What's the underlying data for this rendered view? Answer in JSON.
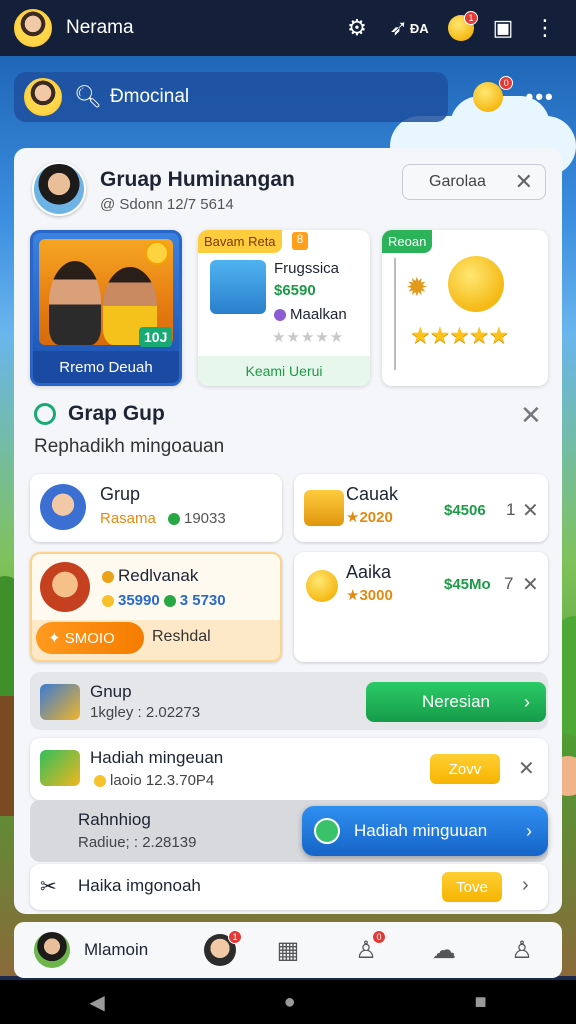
{
  "topbar": {
    "title": "Nerama",
    "label_small": "ĐA",
    "badge": "1"
  },
  "search": {
    "value": "Đmocinal",
    "badge": "0"
  },
  "group": {
    "title": "Gruap Huminangan",
    "subtitle": "@ Sdonn 12/7 5614",
    "button": "Garolaa"
  },
  "feature_cards": {
    "card1": {
      "label": "Rremo Deuah",
      "count": "10J"
    },
    "card2": {
      "tag": "Bavam Reta",
      "num": "8",
      "title": "Frugssica",
      "price": "$6590",
      "item": "Maalkan",
      "foot": "Keami Uerui"
    },
    "card3": {
      "tag": "Reoan"
    }
  },
  "section": {
    "title": "Grap Gup",
    "subtitle": "Rephadikh mingoauan"
  },
  "cards": {
    "c1": {
      "title": "Grup",
      "sub_label": "Rasama",
      "sub_value": "19033"
    },
    "c2": {
      "title": "Cauak",
      "value": "★2020",
      "price": "$4506",
      "count": "1"
    },
    "c3": {
      "title": "Redlvanak",
      "v1": "35990",
      "v2": "3 5730",
      "action": "SMOIO",
      "action_label": "Reshdal"
    },
    "c4": {
      "title": "Aaika",
      "value": "★3000",
      "price": "$45Mo",
      "count": "7"
    }
  },
  "rows": {
    "r1": {
      "title": "Gnup",
      "sub": "1kgley : 2.02273",
      "button": "Neresian"
    },
    "r2": {
      "title": "Hadiah mingeuan",
      "sub": "laoio 12.3.70P4",
      "button": "Zovv"
    },
    "r3": {
      "title": "Rahnhiog",
      "sub": "Radiue; : 2.28139",
      "button": "Hadiah minguuan"
    },
    "r4": {
      "title": "Haika imgonoah",
      "button": "Tove"
    }
  },
  "bottomnav": {
    "label": "Mlamoin",
    "badge1": "1",
    "badge2": "0"
  }
}
